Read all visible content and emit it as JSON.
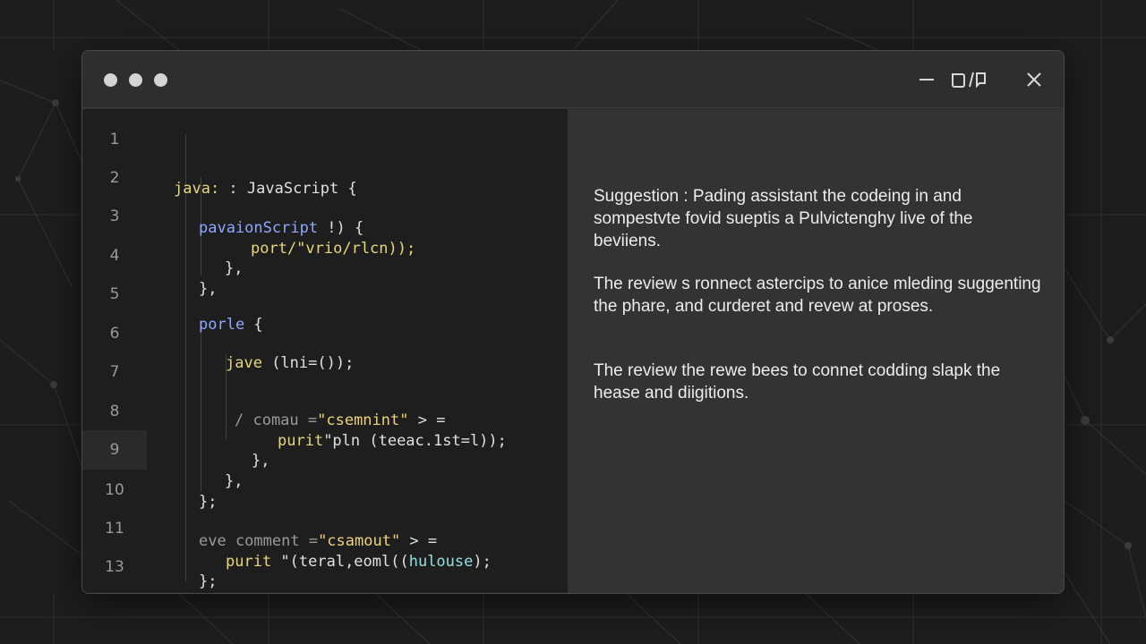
{
  "window": {
    "controls": [
      "minimize-icon",
      "restore-icon",
      "close-icon"
    ]
  },
  "editor": {
    "line_numbers": [
      "1",
      "2",
      "3",
      "4",
      "5",
      "6",
      "7",
      "8",
      "9",
      "10",
      "11",
      "13"
    ],
    "active_line": "9",
    "lines": [
      {
        "t1": "java:",
        "t2": " : JavaScript {"
      },
      {
        "t1": "pavaionScript",
        "t2": " !) {"
      },
      {
        "t1": "port/\"vrio/rlcn));"
      },
      {
        "t1": "},"
      },
      {
        "t1": "},"
      },
      {
        "t1": "porle",
        "t2": " {"
      },
      {
        "t1": "jave",
        "t2": " (lni=());"
      },
      {
        "t1": "/ comau =",
        "t2": "\"csemnint\"",
        "t3": " > ="
      },
      {
        "t1": "purit",
        "t2": "\"pln (teeac.1st=l));"
      },
      {
        "t1": "},"
      },
      {
        "t1": "},"
      },
      {
        "t1": "};"
      },
      {
        "t1": "eve comment =",
        "t2": "\"csamout\"",
        "t3": " > ="
      },
      {
        "t1": "purit",
        "t2": " \"(teral,eoml((",
        "t3": "hulouse",
        "t4": ");"
      },
      {
        "t1": "};"
      },
      {
        "t1": "}"
      }
    ]
  },
  "suggestion": {
    "paragraphs": [
      "Suggestion : Pading assistant the codeing in and sompestvte fovid sueptis a Pulvictenghy live of the beviiens.",
      "The review s ronnect astercips to anice mleding suggenting the phare, and curderet and revew at proses.",
      "The review the rewe bees to connet codding slapk the hease and diigitions."
    ]
  },
  "colors": {
    "background": "#1d1d1d",
    "editor_bg": "#1e1e1e",
    "panel_bg": "#333333",
    "keyword_yellow": "#e6d77a",
    "keyword_blue": "#8fa8ff",
    "keyword_cyan": "#8fe0e0"
  }
}
